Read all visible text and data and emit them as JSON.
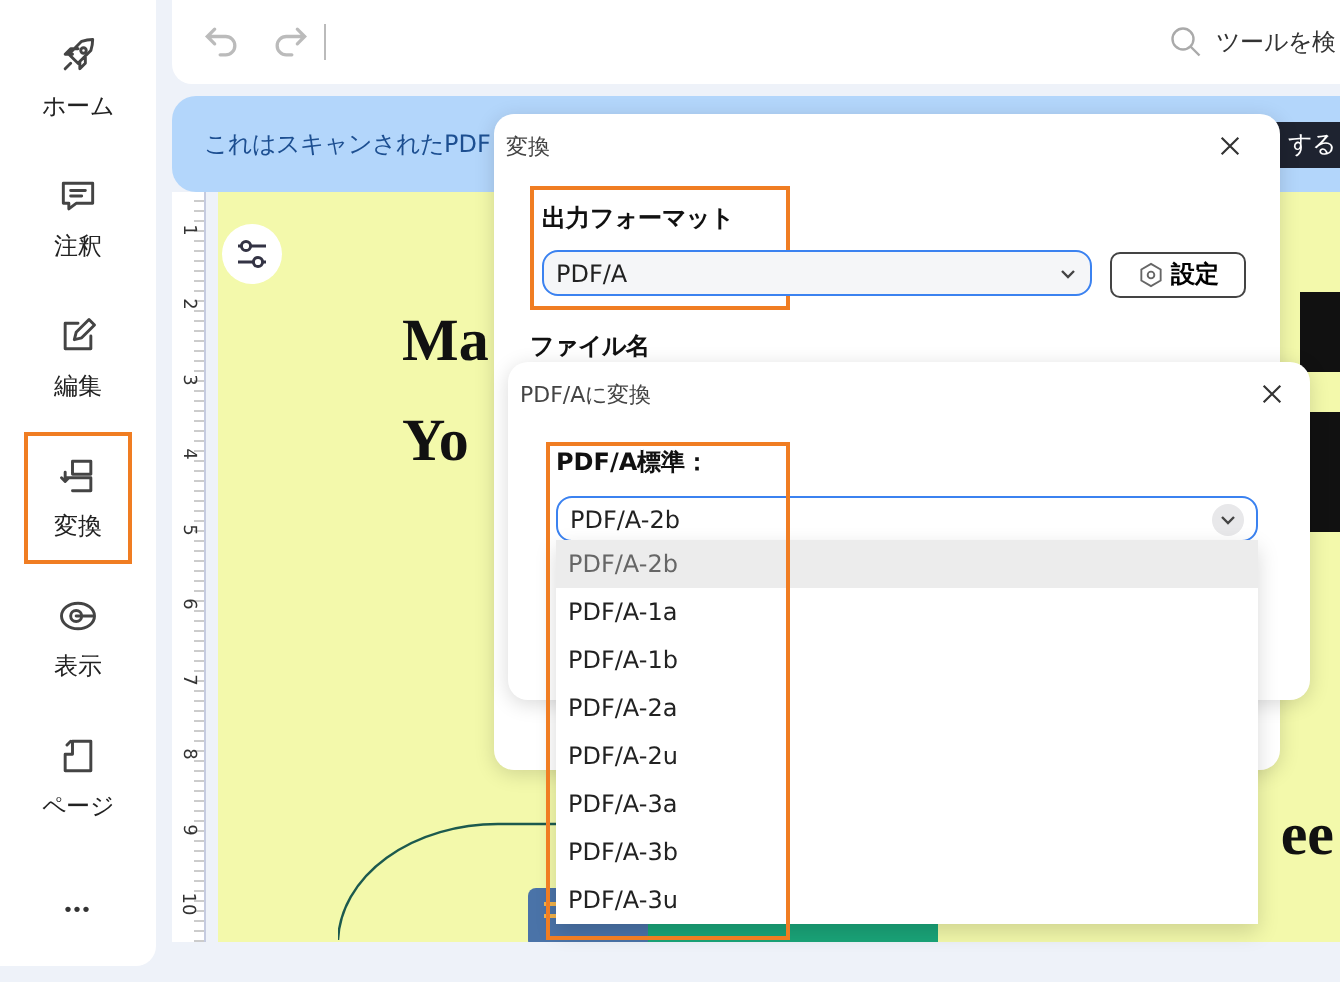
{
  "sidebar": {
    "items": [
      {
        "label": "ホーム",
        "highlighted": false
      },
      {
        "label": "注釈",
        "highlighted": false
      },
      {
        "label": "編集",
        "highlighted": false
      },
      {
        "label": "変換",
        "highlighted": true
      },
      {
        "label": "表示",
        "highlighted": false
      },
      {
        "label": "ページ",
        "highlighted": false
      }
    ],
    "more": "•••"
  },
  "toolbar": {
    "search": {
      "placeholder": "ツールを検"
    }
  },
  "banner": {
    "text": "これはスキャンされたPDF",
    "action": "する"
  },
  "ruler": {
    "marks": [
      "1",
      "2",
      "3",
      "4",
      "5",
      "6",
      "7",
      "8",
      "9",
      "10"
    ]
  },
  "document": {
    "heading_lines": [
      "Ma",
      "Yo"
    ],
    "right_fragment": "ee"
  },
  "convert_dialog": {
    "title": "変換",
    "format_label": "出力フォーマット",
    "format_value": "PDF/A",
    "settings_button": "設定",
    "file_name_label": "ファイル名",
    "format_highlighted": true
  },
  "pdfa_dialog": {
    "title": "PDF/Aに変換",
    "standard_label": "PDF/A標準：",
    "standard_value": "PDF/A-2b",
    "standard_highlighted": true,
    "options": [
      {
        "label": "PDF/A-2b",
        "selected": true
      },
      {
        "label": "PDF/A-1a",
        "selected": false
      },
      {
        "label": "PDF/A-1b",
        "selected": false
      },
      {
        "label": "PDF/A-2a",
        "selected": false
      },
      {
        "label": "PDF/A-2u",
        "selected": false
      },
      {
        "label": "PDF/A-3a",
        "selected": false
      },
      {
        "label": "PDF/A-3b",
        "selected": false
      },
      {
        "label": "PDF/A-3u",
        "selected": false
      }
    ]
  }
}
